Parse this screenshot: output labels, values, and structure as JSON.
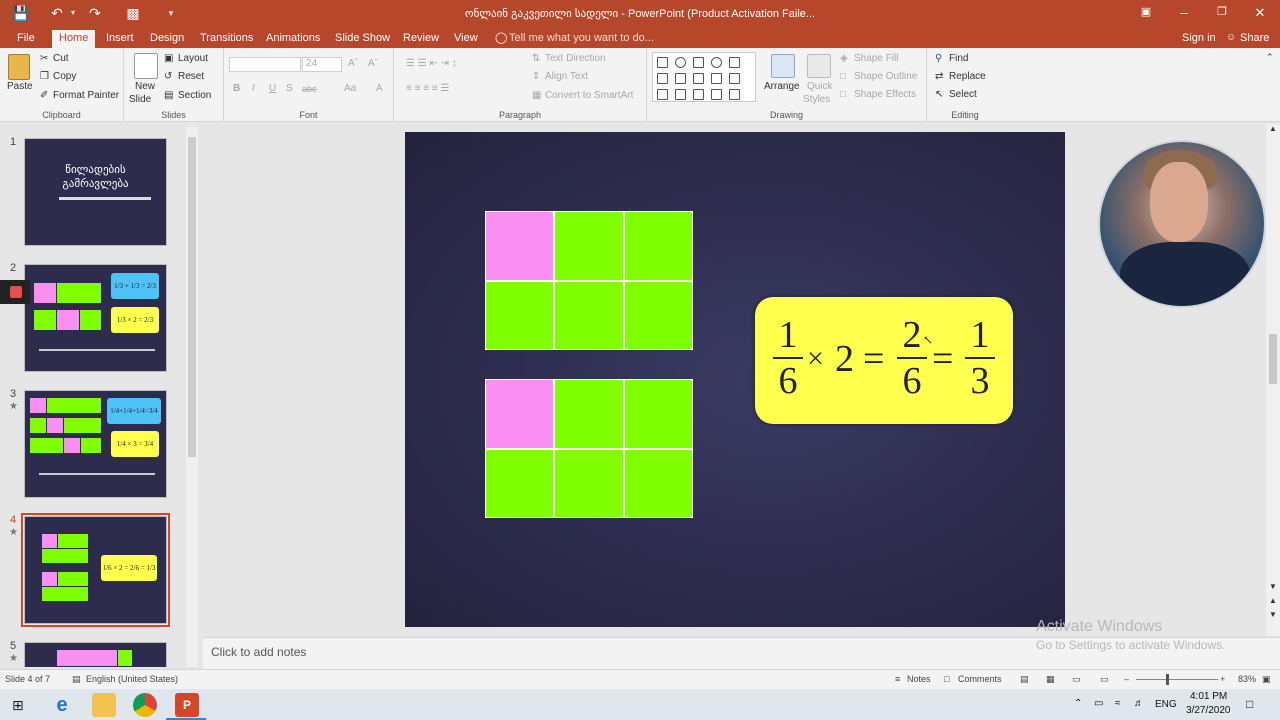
{
  "titlebar": {
    "title": "ონლაინ გაკვეთილი სადელი - PowerPoint (Product Activation Faile...",
    "qa_icons": [
      "save-icon",
      "undo-icon",
      "redo-icon",
      "present-icon",
      "customize-icon"
    ],
    "controls": [
      "ribbon-display-icon",
      "minimize-icon",
      "restore-icon",
      "close-icon"
    ]
  },
  "tabs": {
    "items": [
      "File",
      "Home",
      "Insert",
      "Design",
      "Transitions",
      "Animations",
      "Slide Show",
      "Review",
      "View"
    ],
    "active": "Home",
    "tell_me": "Tell me what you want to do...",
    "signin": "Sign in",
    "share": "Share"
  },
  "ribbon": {
    "clipboard": {
      "label": "Clipboard",
      "paste": "Paste",
      "cut": "Cut",
      "copy": "Copy",
      "format_painter": "Format Painter"
    },
    "slides": {
      "label": "Slides",
      "new_slide": "New",
      "new_slide2": "Slide",
      "layout": "Layout",
      "reset": "Reset",
      "section": "Section"
    },
    "font": {
      "label": "Font",
      "size": "24",
      "bold": "B",
      "italic": "I",
      "underline": "U",
      "strike": "S",
      "spacing": "abc",
      "case": "Aa",
      "color": "A"
    },
    "paragraph": {
      "label": "Paragraph",
      "text_direction": "Text Direction",
      "align_text": "Align Text",
      "convert": "Convert to SmartArt"
    },
    "drawing": {
      "label": "Drawing",
      "arrange": "Arrange",
      "quick": "Quick",
      "styles": "Styles",
      "shape_fill": "Shape Fill",
      "shape_outline": "Shape Outline",
      "shape_effects": "Shape Effects"
    },
    "editing": {
      "label": "Editing",
      "find": "Find",
      "replace": "Replace",
      "select": "Select"
    }
  },
  "thumbnails": [
    {
      "num": "1",
      "title": "წილადების",
      "title2": "გამრავლება"
    },
    {
      "num": "2",
      "f1": "1/3 + 1/3 = 2/3",
      "f2": "1/3 × 2 = 2/3"
    },
    {
      "num": "3",
      "f1": "1/4+1/4+1/4=3/4",
      "f2": "1/4 × 3 = 3/4"
    },
    {
      "num": "4",
      "f1": "1/6 × 2 = 2/6 = 1/3"
    },
    {
      "num": "5"
    }
  ],
  "slide": {
    "grid1": [
      "pink",
      "green",
      "green",
      "green",
      "green",
      "green"
    ],
    "grid2": [
      "pink",
      "green",
      "green",
      "green",
      "green",
      "green"
    ],
    "equation": {
      "a_num": "1",
      "a_den": "6",
      "times": "×",
      "b": "2",
      "eq1": "=",
      "c_num": "2",
      "c_den": "6",
      "eq2": "=",
      "d_num": "1",
      "d_den": "3"
    }
  },
  "colors": {
    "accent": "#b7472a",
    "pink": "#f98ff0",
    "green": "#80ff00",
    "yellow": "#ffff4d",
    "slide_bg": "#2d2c4c"
  },
  "notes": {
    "placeholder": "Click to add notes"
  },
  "watermark": {
    "line1": "Activate Windows",
    "line2": "Go to Settings to activate Windows."
  },
  "status": {
    "slide": "Slide 4 of 7",
    "language": "English (United States)",
    "notes": "Notes",
    "comments": "Comments",
    "zoom": "83%"
  },
  "taskbar": {
    "lang": "ENG",
    "time": "4:01 PM",
    "date": "3/27/2020"
  }
}
